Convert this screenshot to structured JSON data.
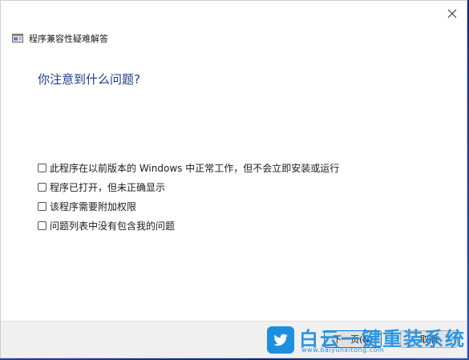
{
  "window": {
    "title": "程序兼容性疑难解答",
    "close_icon": "close-icon"
  },
  "main": {
    "heading": "你注意到什么问题?",
    "options": [
      {
        "label": "此程序在以前版本的 Windows 中正常工作，但不会立即安装或运行",
        "checked": false
      },
      {
        "label": "程序已打开，但未正确显示",
        "checked": false
      },
      {
        "label": "该程序需要附加权限",
        "checked": false
      },
      {
        "label": "问题列表中没有包含我的问题",
        "checked": false
      }
    ]
  },
  "footer": {
    "next_label": "下一页(N)",
    "cancel_label": "取消"
  },
  "watermark": {
    "title": "白云一键重装系统",
    "url": "www.baiyunxitong.com",
    "color": "#1d8fe0"
  },
  "colors": {
    "heading": "#1e3a8a",
    "accent": "#0078d4"
  }
}
